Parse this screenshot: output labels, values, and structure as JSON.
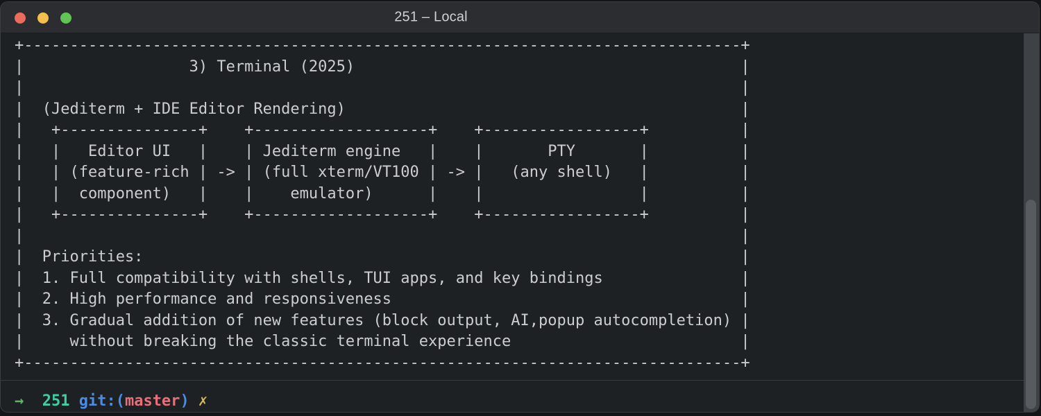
{
  "window": {
    "title": "251 – Local"
  },
  "terminal": {
    "output_lines": [
      "+------------------------------------------------------------------------------+",
      "|                  3) Terminal (2025)                                          |",
      "|                                                                              |",
      "|  (Jediterm + IDE Editor Rendering)                                           |",
      "|   +---------------+    +-------------------+    +-----------------+          |",
      "|   |   Editor UI   |    | Jediterm engine   |    |       PTY       |          |",
      "|   | (feature-rich | -> | (full xterm/VT100 | -> |   (any shell)   |          |",
      "|   |  component)   |    |    emulator)      |    |                 |          |",
      "|   +---------------+    +-------------------+    +-----------------+          |",
      "|                                                                              |",
      "|  Priorities:                                                                 |",
      "|  1. Full compatibility with shells, TUI apps, and key bindings               |",
      "|  2. High performance and responsiveness                                      |",
      "|  3. Gradual addition of new features (block output, AI,popup autocompletion) |",
      "|     without breaking the classic terminal experience                         |",
      "+------------------------------------------------------------------------------+"
    ]
  },
  "prompt": {
    "arrow": "→",
    "cwd": "251",
    "git_prefix": "git:(",
    "branch": "master",
    "git_suffix": ")",
    "dirty_marker": "✗"
  },
  "colors": {
    "window_bg": "#1e2124",
    "titlebar_bg": "#2b2d30",
    "terminal_text": "#cbcdd2",
    "close": "#ec6a5e",
    "minimize": "#f4be4f",
    "zoom": "#61c554",
    "prompt_arrow": "#62b464",
    "prompt_cwd": "#3ecfa4",
    "prompt_git": "#4a8ce8",
    "prompt_branch": "#ec6e78",
    "prompt_dirty": "#d6bc52"
  }
}
